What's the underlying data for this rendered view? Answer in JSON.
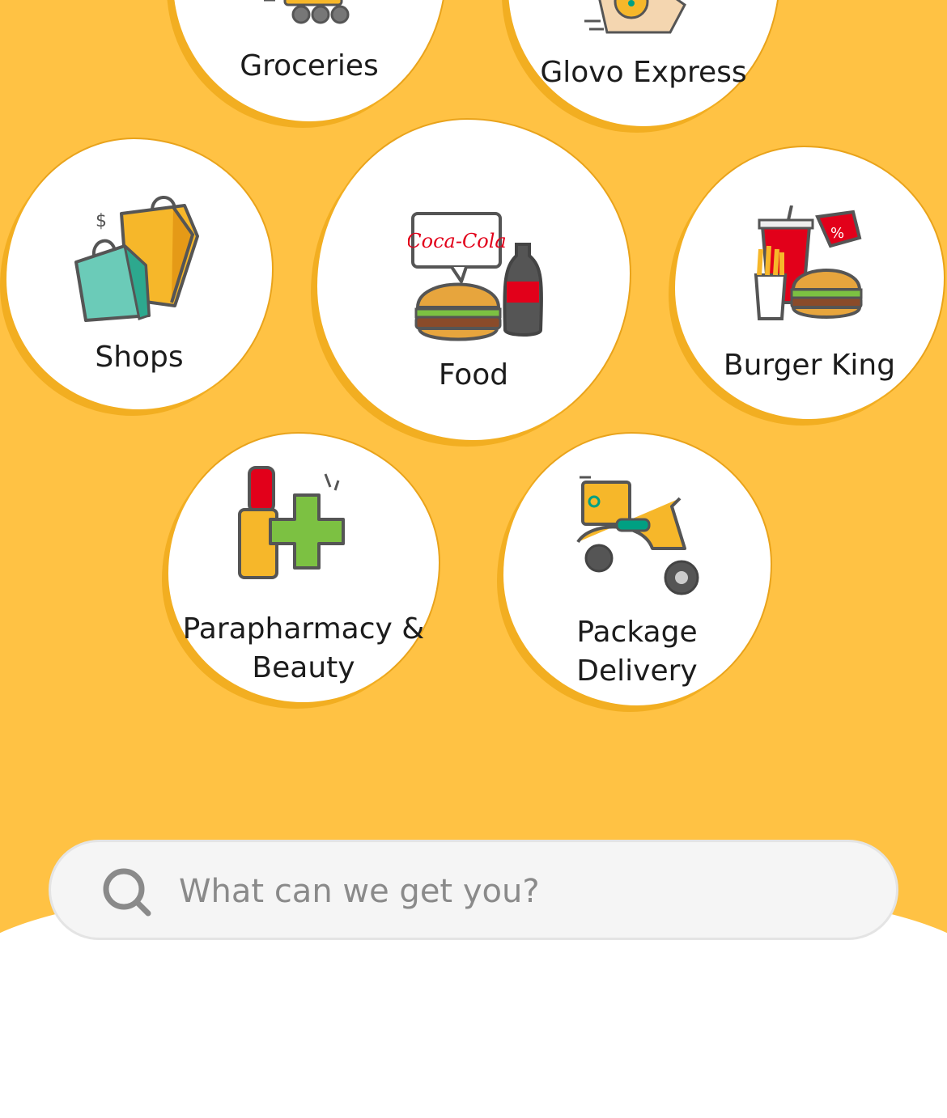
{
  "categories": {
    "groceries": {
      "label": "Groceries",
      "icon": "shopping-cart-icon"
    },
    "glovo_express": {
      "label": "Glovo Express",
      "icon": "express-bag-icon"
    },
    "shops": {
      "label": "Shops",
      "icon": "shopping-bags-icon"
    },
    "food": {
      "label": "Food",
      "icon": "burger-and-cola-icon",
      "sign_text": "Coca-Cola"
    },
    "burger_king": {
      "label": "Burger King",
      "icon": "burger-menu-icon"
    },
    "parapharmacy": {
      "label_line1": "Parapharmacy &",
      "label_line2": "Beauty",
      "icon": "lipstick-pharmacy-cross-icon"
    },
    "package_delivery": {
      "label_line1": "Package",
      "label_line2": "Delivery",
      "icon": "delivery-scooter-icon"
    }
  },
  "search": {
    "placeholder": "What can we get you?",
    "icon": "search-icon"
  },
  "colors": {
    "background": "#FFC244",
    "bubble": "#FFFFFF",
    "accent_green": "#00A082",
    "text": "#1C1C1C"
  }
}
